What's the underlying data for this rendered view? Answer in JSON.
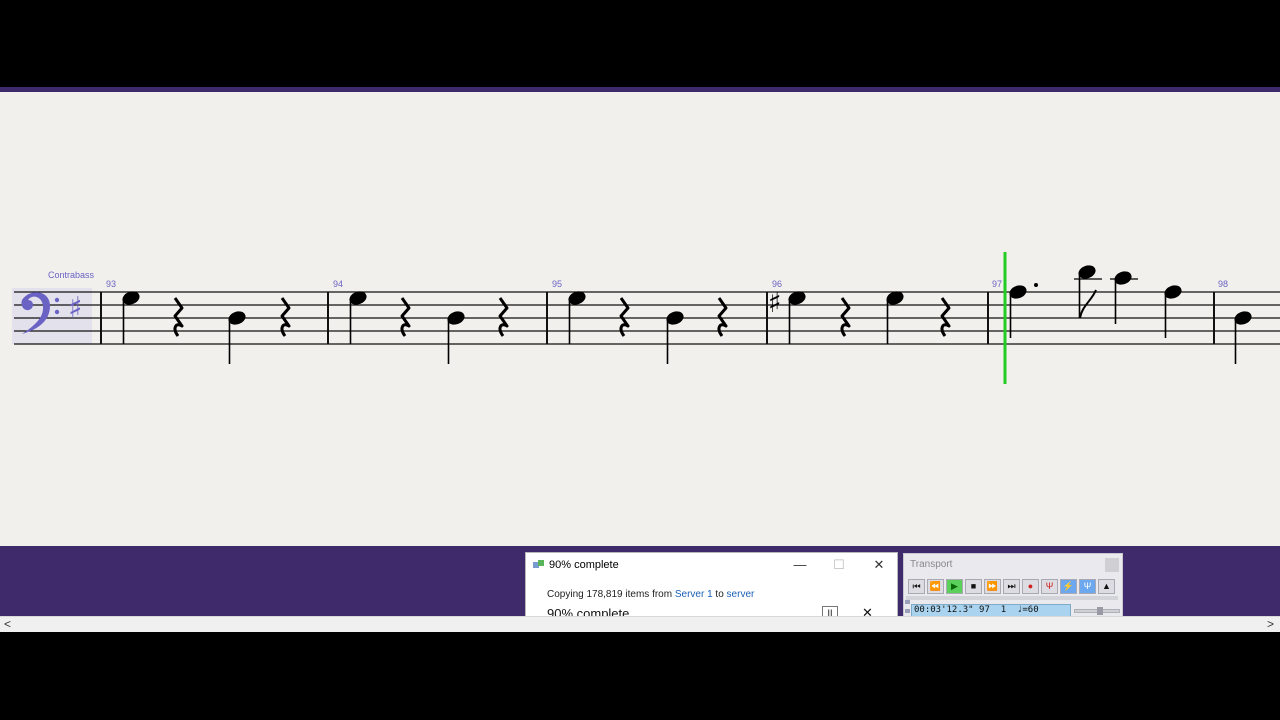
{
  "score": {
    "instrument_label": "Contrabass",
    "measures": [
      "93",
      "94",
      "95",
      "96",
      "97",
      "98"
    ]
  },
  "colors": {
    "band": "#3f2b6b",
    "playhead": "#22cc22",
    "accent_label": "#6a63c4"
  },
  "copy_dialog": {
    "title": "90% complete",
    "copy_prefix": "Copying 178,819 items from ",
    "source": "Server 1",
    "to_word": " to ",
    "destination": "server",
    "percent_text": "90% complete",
    "progress_percent": 90,
    "minimize_glyph": "—",
    "maximize_glyph": "☐",
    "close_glyph": "✕",
    "pause_glyph": "II",
    "cancel_glyph": "✕"
  },
  "transport": {
    "title": "Transport",
    "readout": "00:03'12.3\" 97  1  ♩=60",
    "buttons": [
      {
        "name": "rewind-to-start-icon",
        "glyph": "⏮"
      },
      {
        "name": "rewind-icon",
        "glyph": "⏪"
      },
      {
        "name": "play-icon",
        "glyph": "▶"
      },
      {
        "name": "stop-icon",
        "glyph": "■"
      },
      {
        "name": "fast-forward-icon",
        "glyph": "⏩"
      },
      {
        "name": "forward-to-end-icon",
        "glyph": "⏭"
      },
      {
        "name": "record-icon",
        "glyph": "●"
      },
      {
        "name": "live-tempo-icon",
        "glyph": "Ψ"
      },
      {
        "name": "flex-icon",
        "glyph": "⚡"
      },
      {
        "name": "click-icon",
        "glyph": "Ψ"
      },
      {
        "name": "metronome-icon",
        "glyph": "▲"
      }
    ]
  },
  "scroll": {
    "left_arrow": "<",
    "right_arrow": ">"
  }
}
